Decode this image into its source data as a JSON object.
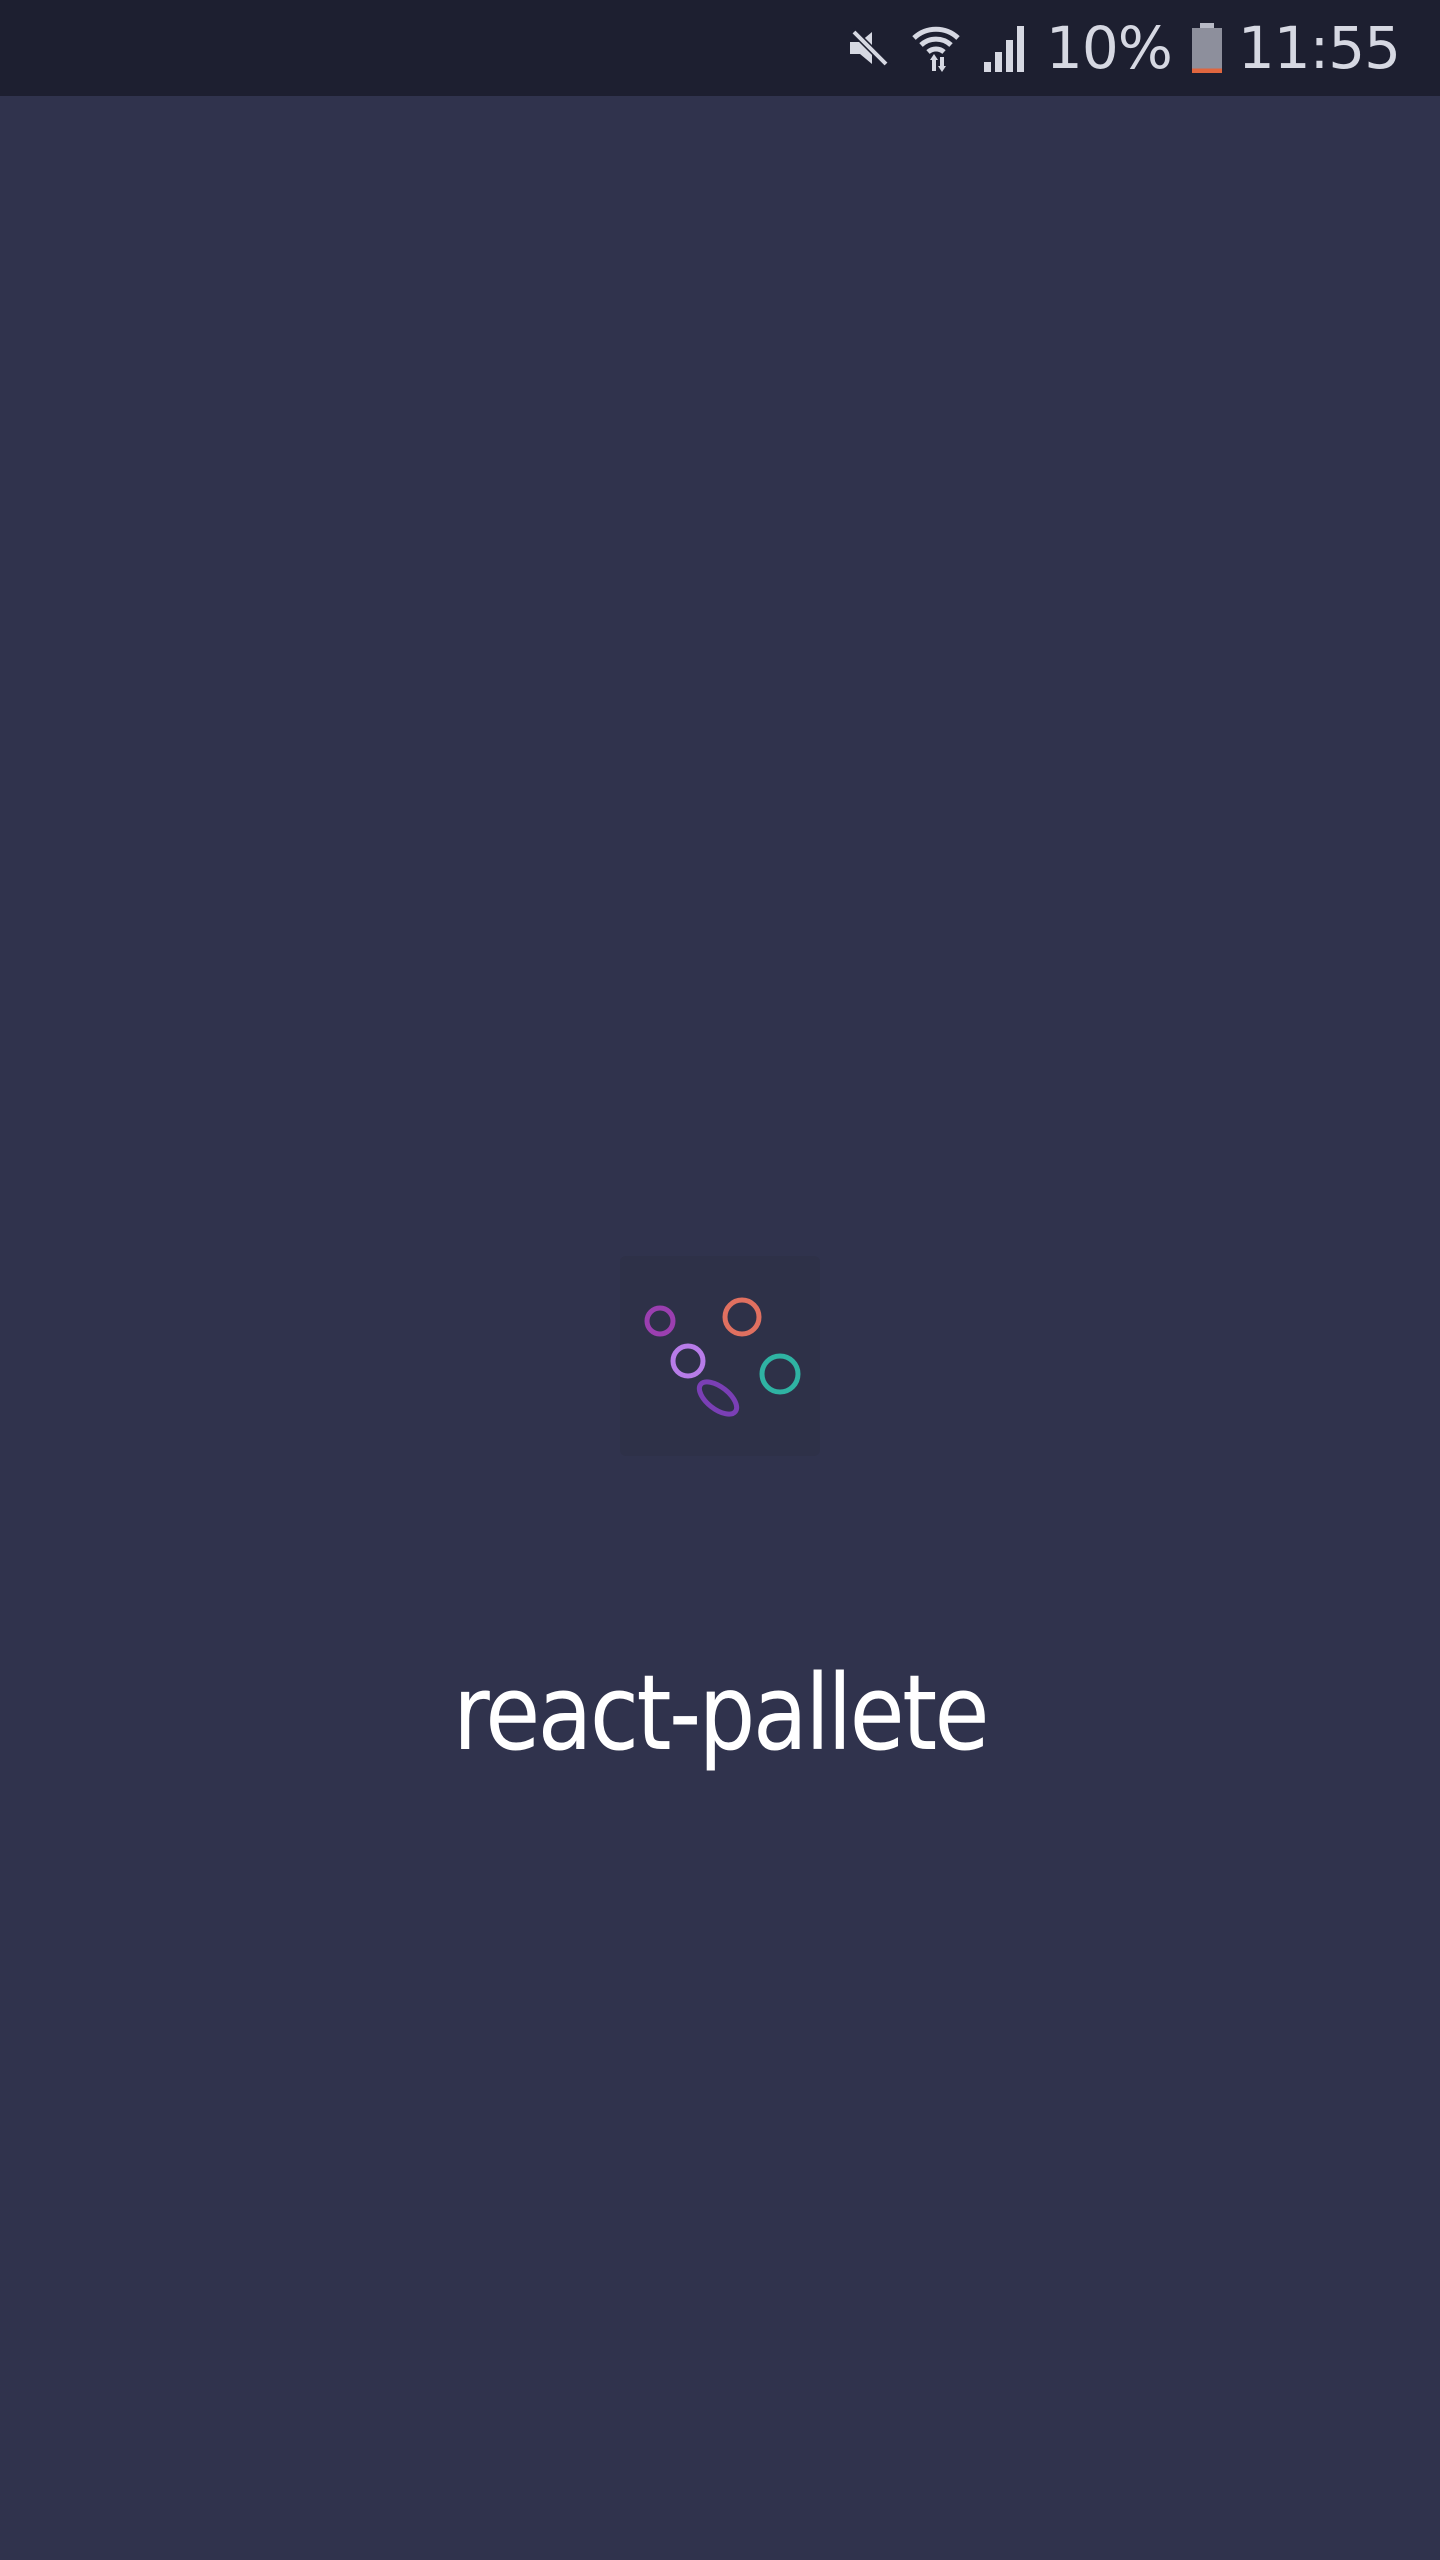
{
  "status_bar": {
    "battery_percent": "10%",
    "time": "11:55",
    "icons": [
      "mute-icon",
      "wifi-icon",
      "signal-icon",
      "battery-icon"
    ],
    "battery_level": 0.1,
    "battery_low_color": "#e0663f"
  },
  "splash": {
    "title": "react-pallete",
    "logo_colors": {
      "purple": "#9b3fb0",
      "coral": "#e07060",
      "lavender": "#b77ce8",
      "teal": "#2fb3a3",
      "violet": "#7a3fb5"
    },
    "background": "#30334d"
  }
}
